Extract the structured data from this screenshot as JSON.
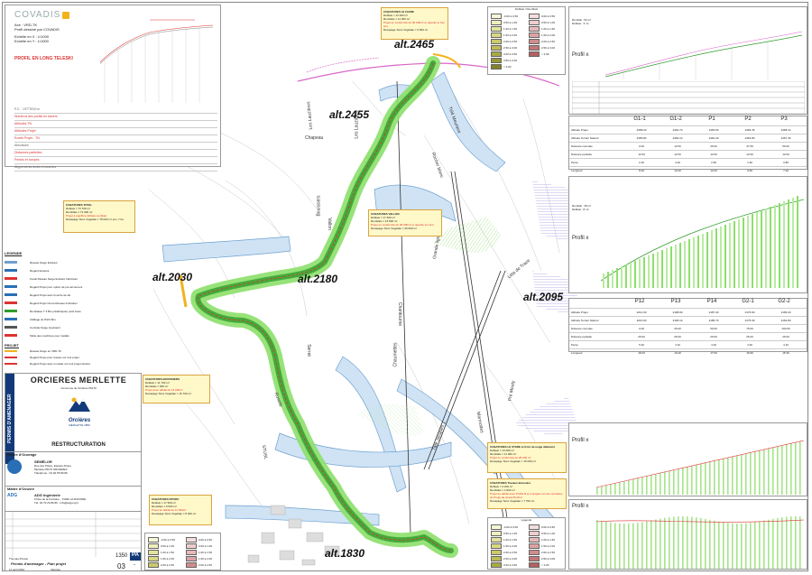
{
  "brand": {
    "name": "COVADIS",
    "accent": "#f3b21b"
  },
  "profile_long": {
    "lines": [
      "Axe : VRD-TK",
      "Profil dessiné par COVADIS",
      "Echelle en X : 1/1000",
      "Echelle en Y : 1/1000"
    ],
    "title": "PROFIL EN LONG TELESKI",
    "rows": [
      "P.C. : VETTE00 m",
      "Numéros des profils en travers",
      "Altitudes TN",
      "Altitudes Projet",
      "Ecarts Projet - TN",
      "Abscisses",
      "Distances partielles",
      "Pentes et rampes",
      "Alignements droits et courbes"
    ],
    "row_colors": [
      "#666",
      "#d33",
      "#d33",
      "#d33",
      "#d33",
      "#666",
      "#d33",
      "#d33",
      "#666"
    ]
  },
  "map": {
    "altitudes": [
      "alt.2465",
      "alt.2455",
      "alt.2030",
      "alt.2180",
      "alt.2095",
      "alt.1830"
    ],
    "road_labels": [
      "Les Lauzières",
      "Les Lauzières",
      "Rocher blanc",
      "Télé Meurtent",
      "Grande ligne",
      "Télé Jacques 1"
    ],
    "vertical_labels": [
      "Bouissiers",
      "Vallon",
      "Serret",
      "Chaumettes",
      "Chantourne",
      "Pré Mouty",
      "Marmottes",
      "Roselle",
      "STUSL",
      "Léta de Trace",
      "Chapeau"
    ]
  },
  "notes": [
    {
      "title": "CUBATURES LE FAVRE",
      "lines": [
        "Déblais = 13 200 m³",
        "Remblais = 11 300 m³"
      ],
      "red": "Projet en conformité de 50 000m³ et répartie le foot pris",
      "foot": "Décapage Terre Végétale = 6 500 m²"
    },
    {
      "title": "CUBATURES TOTAL",
      "lines": [
        "Déblais = 73 700 m³",
        "Remblais = 72 000 m³"
      ],
      "red": "Projet à équilibre déblais remblais",
      "foot": "Décapage Terre Végétale = 78 000 m² env. 7 ha"
    },
    {
      "title": "CUBATURES VALLON",
      "lines": [
        "Déblais = 17 600 m³",
        "Remblais = 15 800 m³"
      ],
      "red": "Projet en conformité de 28 000m³ et répartie sur foot",
      "foot": "Décapage Terre Végétale = 26 000 m²"
    },
    {
      "title": "CUBATURES BOUISSIERS",
      "lines": [
        "Déblais = 11 700 m³",
        "Remblais = 560 m³"
      ],
      "red": "Projet avec déblai de 13 000m³",
      "foot": "Décapage Terre Végétale = 16 700 m²"
    },
    {
      "title": "CUBATURES LE STADE et front de neige débutant",
      "lines": [
        "Déblais = 13 000 m³",
        "Remblais = 11 000 m³"
      ],
      "red": "Projet en conformité de 28 000 m³",
      "foot": "Décapage Terre Végétale = 15 000 m²"
    },
    {
      "title": "CUBATURES Travaux Boissière",
      "lines": [
        "Déblais = 3 200 m³",
        "Remblais = 4 500 m³"
      ],
      "red": "Projet au déblai avec Profils B et à projeter sur les conduites du Projet de Grand Rocher",
      "foot": "Décapage Terre Végétale = 7 700 m²"
    },
    {
      "title": "CUBATURES PATIOU",
      "lines": [
        "Déblais = 17 500 m³",
        "Remblais = 9 500 m³"
      ],
      "red": "Projet au déblai de 11 000m³",
      "foot": "Décapage Terre Végétale = 8 400 m²"
    }
  ],
  "legend": {
    "title": "LEGENDE",
    "items": [
      "Réseau Neige Existant",
      "Regard Existant",
      "Canal Réseau Neige Existant Individuel",
      "Regard Projet pour option de pré-armement",
      "Regard Projet avec bouche de ski",
      "Regard Projet Ouvre-Réseau Individuel",
      "Remblaise T 3 Bio préfabriquée puits forés",
      "Câblage du Pitch Box",
      "Centrale Neige Inexistant",
      "Table des machines pour installé"
    ],
    "project_title": "PROJET",
    "project_items": [
      "Réseau Neige en VRD-TK",
      "Regard Projet pour réseau sur tout projet",
      "Regard Projet avec nomade sur tout projet sinistré"
    ]
  },
  "cartouche": {
    "title": "ORCIERES MERLETTE",
    "subtitle": "Commune de Orcières 05170",
    "side_label": "PERMIS D'AMENAGER",
    "logo_name": "Orcières",
    "logo_tag": "MERLETTE 1850",
    "section": "RESTRUCTURATION",
    "moa_title": "Maître d'Ouvrage",
    "moa_name": "SEMÉLOR",
    "moa_lines": [
      "Rue des Pistes, Espace Pistes",
      "Merlette 05170 ORCIERES",
      "Téléphone : 04 92 55 89 89"
    ],
    "moe_title": "Maître d'Oeuvre",
    "moe_name": "ADG Ingénierie",
    "moe_lines": [
      "5 Rue de la Fontaine - 73490 LA RAVOIRE",
      "Tél: 04 79 26 86 86 - info@adg-ing.fr"
    ],
    "doc_label": "Permis d'aménager - Plan projet",
    "author": "Thomas Priscal",
    "date": "11 avril 2024",
    "num_a": "1350",
    "num_b": "PA",
    "sheet": "03",
    "rev": "-",
    "footer_mid": "Variante"
  },
  "profile_panels": {
    "top": {
      "label": "Profil x",
      "header": [
        "Remblai : 52 m²",
        "Déblais : 3 m²"
      ],
      "cols": [
        "G1-1",
        "G1-2",
        "P1",
        "P2",
        "P3"
      ],
      "rows": [
        {
          "label": "Altitude Projet",
          "values": [
            "2458.20",
            "2462.70",
            "2465.90",
            "2466.45",
            "2468.10"
          ]
        },
        {
          "label": "Altitude Terrain Naturel",
          "values": [
            "2455.80",
            "2460.10",
            "2462.40",
            "2464.80",
            "2467.30"
          ]
        },
        {
          "label": "Distance cumulée",
          "values": [
            "0.00",
            "12.50",
            "25.00",
            "37.50",
            "50.00"
          ]
        },
        {
          "label": "Distance partielle",
          "values": [
            "12.50",
            "12.50",
            "12.50",
            "12.50",
            "12.50"
          ]
        },
        {
          "label": "Pente",
          "values": [
            "2.40",
            "3.20",
            "2.90",
            "1.90",
            "0.80"
          ]
        },
        {
          "label": "Longueur",
          "values": [
            "8.20",
            "10.40",
            "12.00",
            "9.60",
            "7.40"
          ]
        }
      ]
    },
    "middle_label": "Profil x",
    "middle_header": [
      "Remblai : 35 m²",
      "Déblais : 8 m²"
    ],
    "mid": {
      "cols": [
        "P12",
        "P13",
        "P14",
        "G2-1",
        "G2-2"
      ],
      "rows": [
        {
          "label": "Altitude Projet",
          "values": [
            "2212.30",
            "2198.60",
            "2187.40",
            "2176.90",
            "2166.20"
          ]
        },
        {
          "label": "Altitude Terrain Naturel",
          "values": [
            "2210.90",
            "2196.10",
            "2185.70",
            "2175.30",
            "2164.80"
          ]
        },
        {
          "label": "Distance cumulée",
          "values": [
            "0.00",
            "25.00",
            "50.00",
            "75.00",
            "100.00"
          ]
        },
        {
          "label": "Distance partielle",
          "values": [
            "25.00",
            "25.00",
            "25.00",
            "25.00",
            "25.00"
          ]
        },
        {
          "label": "Pente",
          "values": [
            "5.40",
            "4.10",
            "4.20",
            "4.30",
            "4.10"
          ]
        },
        {
          "label": "Longueur",
          "values": [
            "18.20",
            "19.40",
            "17.60",
            "16.90",
            "15.30"
          ]
        }
      ]
    },
    "bottom_a_label": "Profil x",
    "bottom_b_label": "Profil x"
  },
  "legend_boxes": {
    "top_title": "Déblais / Remblais",
    "bottom_title": "Légende",
    "deblais": [
      "-0.00 à 0.50",
      "0.50 à 1.00",
      "1.00 à 1.50",
      "1.50 à 2.00",
      "2.00 à 2.50",
      "2.50 à 3.00",
      "3.00 à 3.50",
      "3.50 à 4.00",
      "> 4.00"
    ],
    "remblais": [
      "0.00 à 0.50",
      "0.50 à 1.00",
      "1.00 à 1.50",
      "1.50 à 2.00",
      "2.00 à 2.50",
      "2.50 à 3.00",
      "> 3.00"
    ],
    "deblais_colors": [
      "#f6f6d8",
      "#eeeebd",
      "#e3e3a0",
      "#d8d884",
      "#caca6c",
      "#bcbc57",
      "#a9a944",
      "#979735",
      "#83832a"
    ],
    "remblais_colors": [
      "#f6dede",
      "#efcdcd",
      "#e6b8b8",
      "#dca3a3",
      "#d18c8c",
      "#c47676",
      "#b36060"
    ]
  },
  "colors": {
    "road": "#cfe3f5",
    "road_edge": "#6fa0cf",
    "grass": "#8cdf6a",
    "grass_dark": "#2e9c2b",
    "pink": "#d966c6",
    "hatch": "#9e8ee0"
  }
}
